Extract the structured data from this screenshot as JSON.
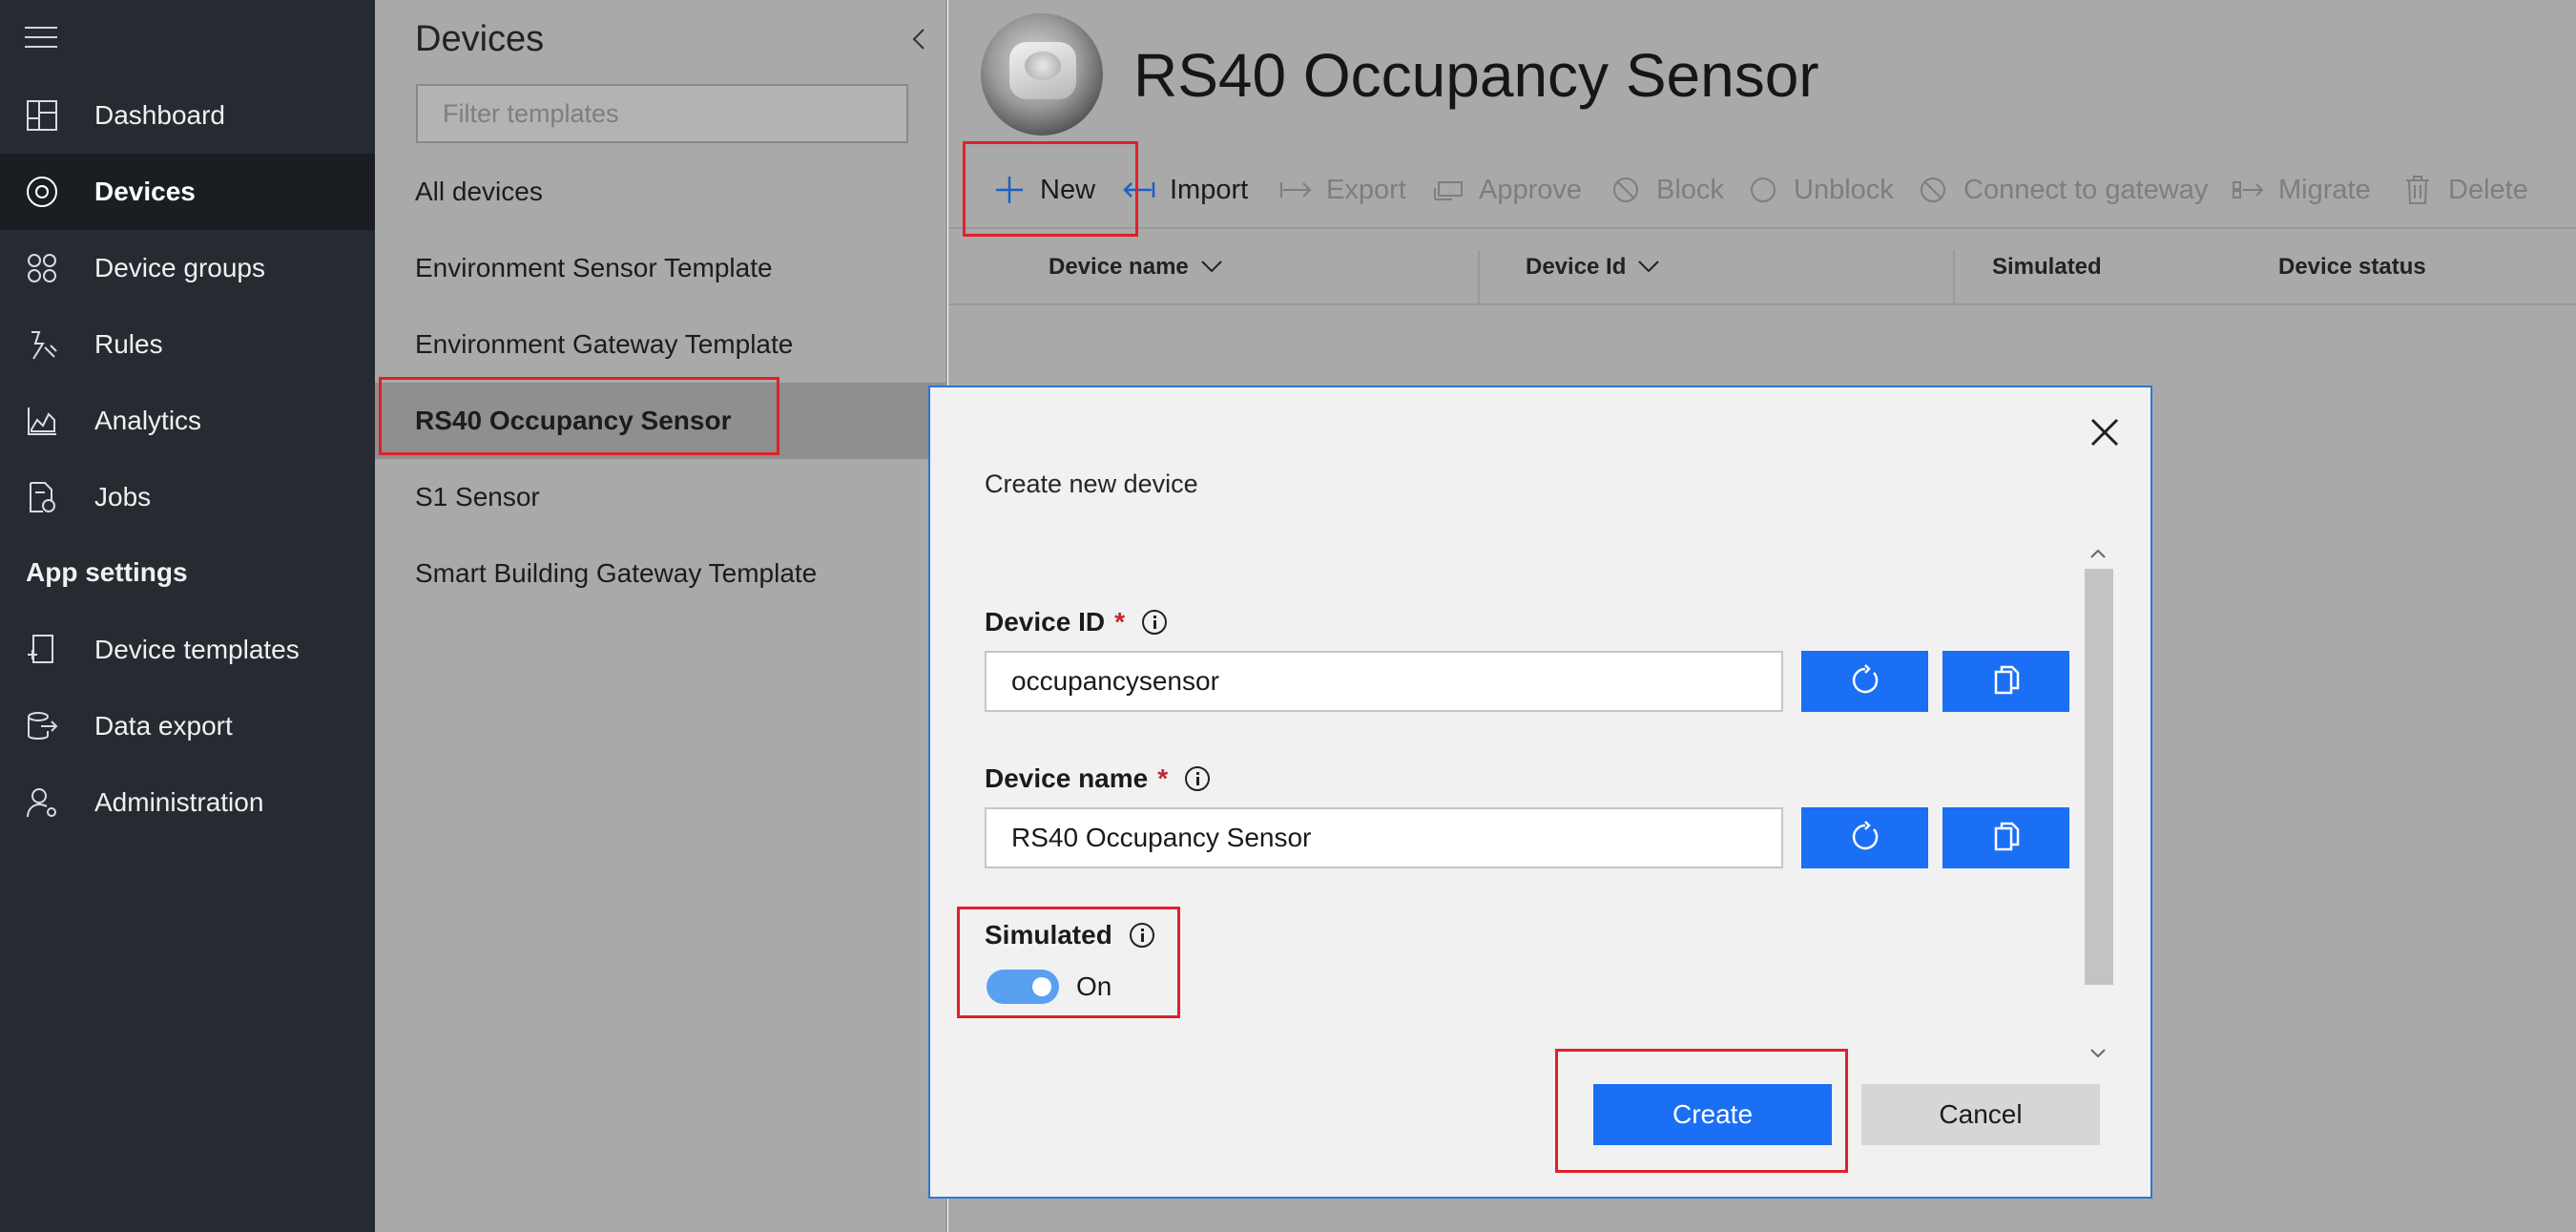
{
  "nav": {
    "items": [
      {
        "label": "Dashboard",
        "icon": "dashboard-icon"
      },
      {
        "label": "Devices",
        "icon": "devices-icon",
        "active": true
      },
      {
        "label": "Device groups",
        "icon": "device-groups-icon"
      },
      {
        "label": "Rules",
        "icon": "rules-icon"
      },
      {
        "label": "Analytics",
        "icon": "analytics-icon"
      },
      {
        "label": "Jobs",
        "icon": "jobs-icon"
      }
    ],
    "section_label": "App settings",
    "settings_items": [
      {
        "label": "Device templates",
        "icon": "device-templates-icon"
      },
      {
        "label": "Data export",
        "icon": "data-export-icon"
      },
      {
        "label": "Administration",
        "icon": "administration-icon"
      }
    ]
  },
  "pane": {
    "title": "Devices",
    "filter_placeholder": "Filter templates",
    "templates": [
      {
        "label": "All devices"
      },
      {
        "label": "Environment Sensor Template"
      },
      {
        "label": "Environment Gateway Template"
      },
      {
        "label": "RS40 Occupancy Sensor",
        "active": true
      },
      {
        "label": "S1 Sensor"
      },
      {
        "label": "Smart Building Gateway Template"
      }
    ]
  },
  "main": {
    "title": "RS40 Occupancy Sensor",
    "toolbar": {
      "new": "New",
      "import": "Import",
      "export": "Export",
      "approve": "Approve",
      "block": "Block",
      "unblock": "Unblock",
      "connect_gateway": "Connect to gateway",
      "migrate": "Migrate",
      "delete": "Delete"
    },
    "columns": {
      "device_name": "Device name",
      "device_id": "Device Id",
      "simulated": "Simulated",
      "device_status": "Device status"
    }
  },
  "modal": {
    "subtitle": "Create new device",
    "device_id_label": "Device ID",
    "device_id_value": "occupancysensor",
    "device_name_label": "Device name",
    "device_name_value": "RS40 Occupancy Sensor",
    "required_mark": "*",
    "simulated_label": "Simulated",
    "simulated_state": "On",
    "create_label": "Create",
    "cancel_label": "Cancel"
  },
  "colors": {
    "accent": "#1a6ff5",
    "highlight": "#e0202a",
    "nav_bg": "#252b31"
  }
}
